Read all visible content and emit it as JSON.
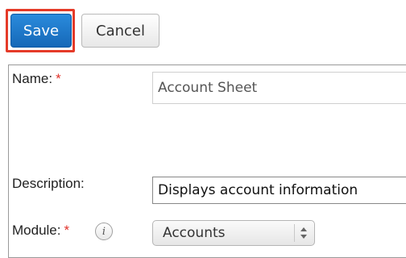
{
  "toolbar": {
    "save_label": "Save",
    "cancel_label": "Cancel"
  },
  "form": {
    "name_label": "Name:",
    "name_required": "*",
    "name_value": "Account Sheet",
    "description_label": "Description:",
    "description_value": "Displays account information",
    "module_label": "Module:",
    "module_required": "*",
    "module_info_icon": "info-icon",
    "module_value": "Accounts"
  },
  "colors": {
    "save_bg": "#1f7ad0",
    "highlight_border": "#e53a28",
    "required_star": "#e0322a"
  }
}
